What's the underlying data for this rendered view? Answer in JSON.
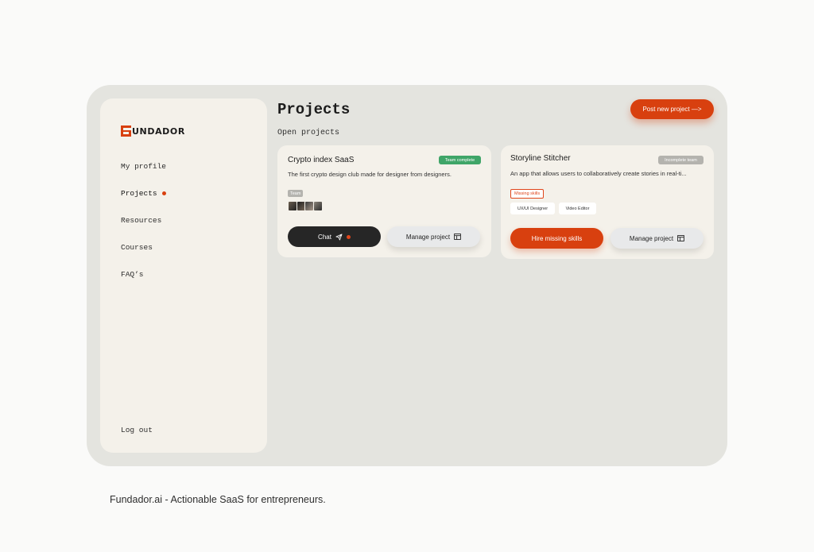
{
  "brand": {
    "name": "UNDADOR",
    "accent": "#d8400f"
  },
  "sidebar": {
    "items": [
      {
        "label": "My profile"
      },
      {
        "label": "Projects",
        "active": true
      },
      {
        "label": "Resources"
      },
      {
        "label": "Courses"
      },
      {
        "label": "FAQ’s"
      }
    ],
    "logout_label": "Log out"
  },
  "header": {
    "title": "Projects",
    "post_button": "Post new project —>"
  },
  "section": {
    "label": "Open projects"
  },
  "projects": [
    {
      "title": "Crypto index SaaS",
      "status": "Team complete",
      "status_color": "#3fa568",
      "description": "The first crypto design club made for designer from designers.",
      "team_label": "Team",
      "chat_label": "Chat",
      "manage_label": "Manage project"
    },
    {
      "title": "Storyline Stitcher",
      "status": "Incomplete team",
      "status_color": "#b4b3ae",
      "description": "An app that allows users to collaboratively create stories in real-ti...",
      "missing_label": "Missing skills",
      "skills": [
        "UX/UI Designer",
        "Video Editor"
      ],
      "hire_label": "Hire missing skills",
      "manage_label": "Manage project"
    }
  ],
  "footer": {
    "caption": "Fundador.ai - Actionable SaaS for entrepreneurs."
  }
}
